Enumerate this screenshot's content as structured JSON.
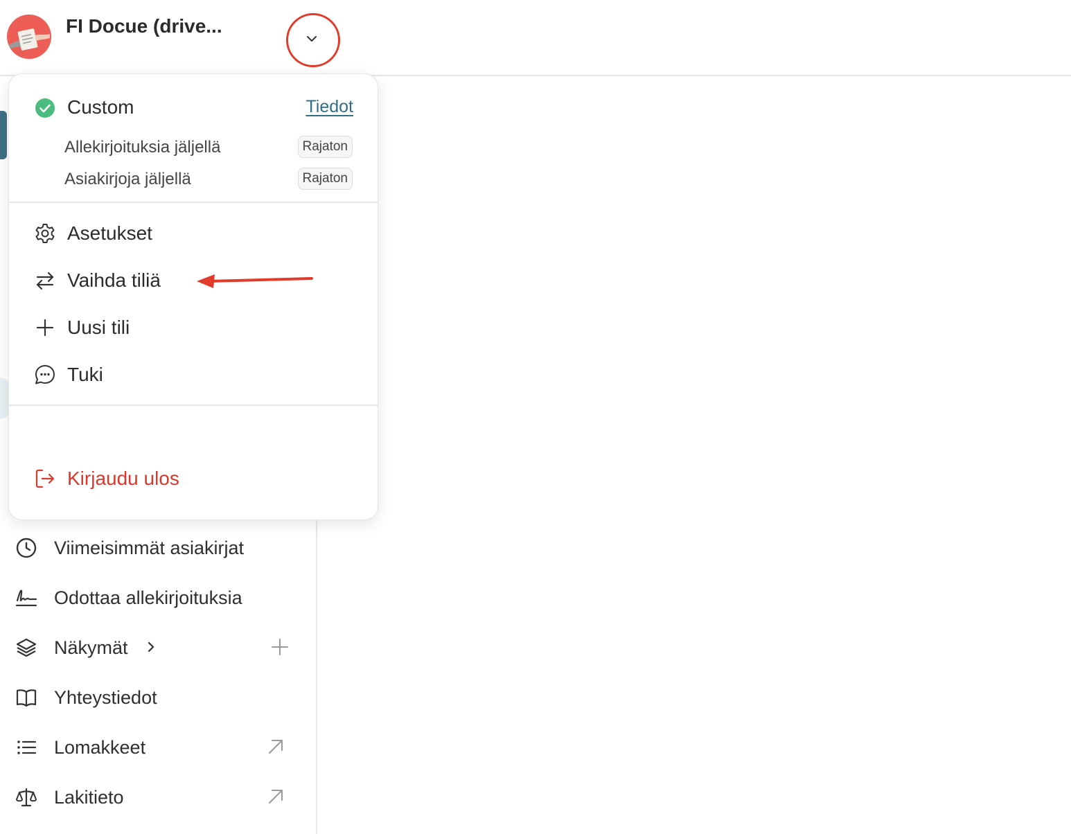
{
  "header": {
    "account_name": "FI Docue (drive..."
  },
  "account_menu": {
    "plan": {
      "name": "Custom",
      "details_link": "Tiedot",
      "quotas": [
        {
          "label": "Allekirjoituksia jäljellä",
          "value": "Rajaton"
        },
        {
          "label": "Asiakirjoja jäljellä",
          "value": "Rajaton"
        }
      ]
    },
    "items": [
      {
        "label": "Asetukset",
        "icon": "gear-icon"
      },
      {
        "label": "Vaihda tiliä",
        "icon": "switch-arrows-icon"
      },
      {
        "label": "Uusi tili",
        "icon": "plus-icon"
      },
      {
        "label": "Tuki",
        "icon": "chat-bubble-icon"
      }
    ],
    "logout": {
      "label": "Kirjaudu ulos",
      "icon": "logout-icon"
    }
  },
  "sidebar": {
    "items": [
      {
        "label": "Viimeisimmät asiakirjat",
        "icon": "clock-icon"
      },
      {
        "label": "Odottaa allekirjoituksia",
        "icon": "signature-icon"
      },
      {
        "label": "Näkymät",
        "icon": "layers-icon",
        "trailing": "plus-icon"
      },
      {
        "label": "Yhteystiedot",
        "icon": "book-icon"
      },
      {
        "label": "Lomakkeet",
        "icon": "list-icon",
        "trailing": "external-arrow-icon"
      },
      {
        "label": "Lakitieto",
        "icon": "scale-icon",
        "trailing": "external-arrow-icon"
      }
    ]
  },
  "colors": {
    "accent_link": "#2e6f86",
    "danger": "#d9382c",
    "success": "#4cbb7f",
    "annotation": "#e23b2b",
    "avatar_bg": "#ec5d56"
  }
}
